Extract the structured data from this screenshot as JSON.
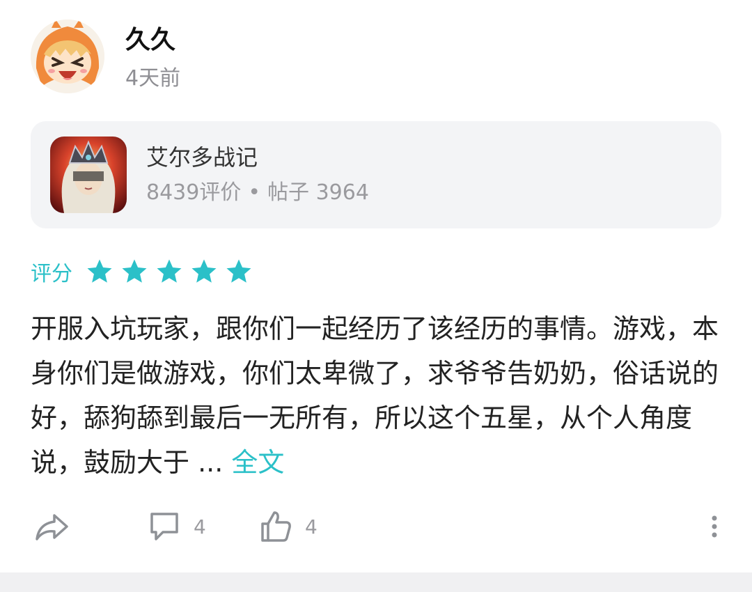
{
  "post": {
    "username": "久久",
    "timestamp": "4天前"
  },
  "game": {
    "name": "艾尔多战记",
    "reviews": "8439评价",
    "separator": "•",
    "posts": "帖子 3964"
  },
  "rating": {
    "label": "评分",
    "stars": 5,
    "max": 5,
    "accent_color": "#2bc0c8"
  },
  "review": {
    "text": "开服入坑玩家，跟你们一起经历了该经历的事情。游戏，本身你们是做游戏，你们太卑微了，求爷爷告奶奶，俗话说的好，舔狗舔到最后一无所有，所以这个五星，从个人角度说，鼓励大于 ...",
    "more_label": "全文"
  },
  "actions": {
    "share_icon": "share-icon",
    "comment_count": "4",
    "like_count": "4"
  }
}
